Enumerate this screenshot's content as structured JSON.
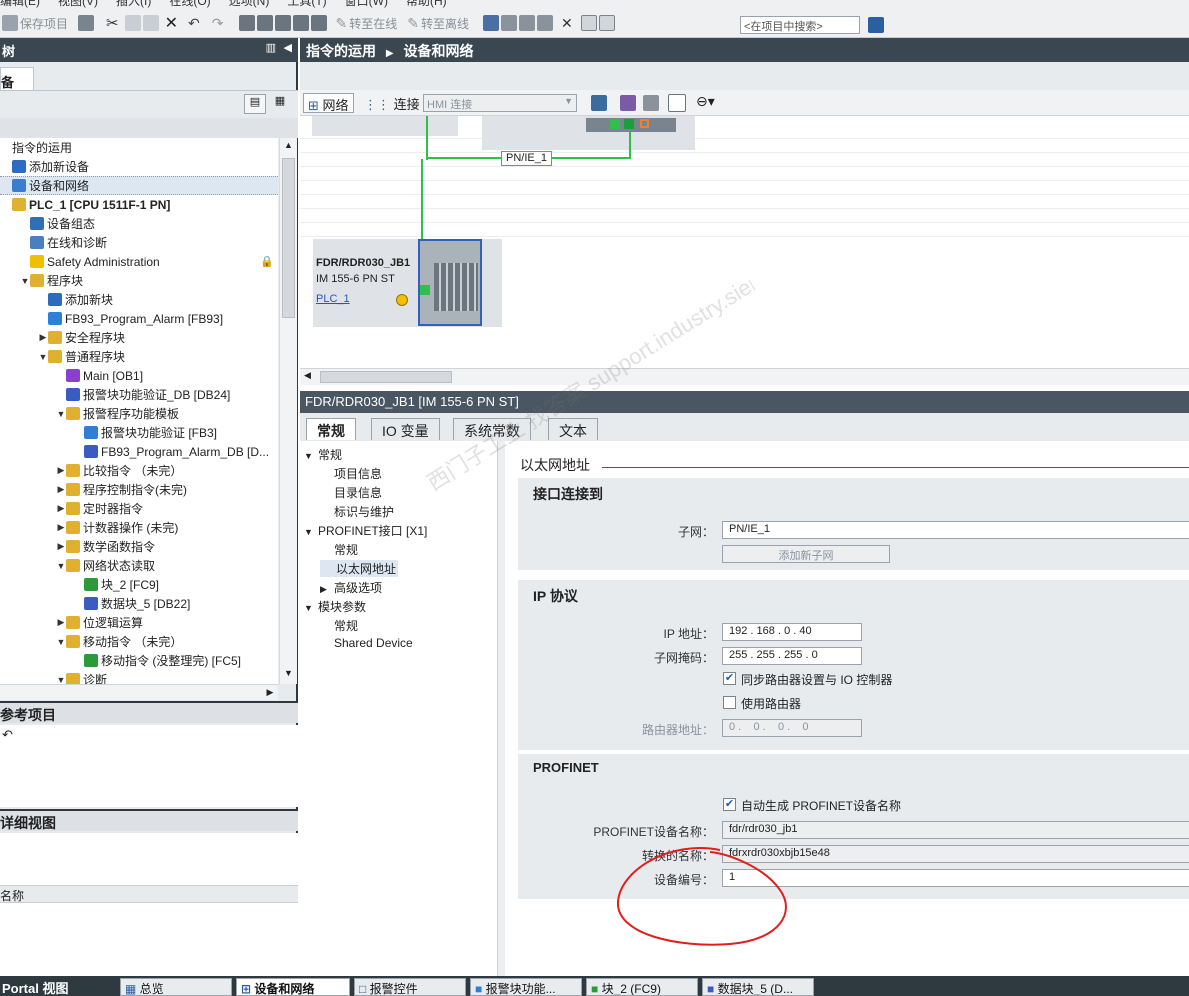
{
  "menu": {
    "items": [
      "编辑(E)",
      "视图(V)",
      "插入(I)",
      "在线(O)",
      "选项(N)",
      "工具(T)",
      "窗口(W)",
      "帮助(H)"
    ]
  },
  "toolbar": {
    "save": "保存项目",
    "go_online": "转至在线",
    "go_offline": "转至离线",
    "search_placeholder": "<在项目中搜索>"
  },
  "left": {
    "panel_title": "树",
    "tab_label": "备",
    "tree": [
      {
        "label": "指令的运用",
        "indent": 0,
        "tw": "",
        "icon": "none"
      },
      {
        "label": "添加新设备",
        "indent": 0,
        "tw": "",
        "icon": "#2c6bc0"
      },
      {
        "label": "设备和网络",
        "indent": 0,
        "tw": "",
        "icon": "#3c7bd0",
        "sel": true
      },
      {
        "label": "PLC_1 [CPU 1511F-1 PN]",
        "indent": 0,
        "tw": "",
        "icon": "#e0b030",
        "bold": true
      },
      {
        "label": "设备组态",
        "indent": 1,
        "tw": "",
        "icon": "#2f6fb5"
      },
      {
        "label": "在线和诊断",
        "indent": 1,
        "tw": "",
        "icon": "#4a7ec0"
      },
      {
        "label": "Safety Administration",
        "indent": 1,
        "tw": "",
        "icon": "#f0c000"
      },
      {
        "label": "程序块",
        "indent": 1,
        "tw": "▼",
        "icon": "#e0b030"
      },
      {
        "label": "添加新块",
        "indent": 2,
        "tw": "",
        "icon": "#2c6bc0"
      },
      {
        "label": "FB93_Program_Alarm [FB93]",
        "indent": 2,
        "tw": "",
        "icon": "#2f7fd8"
      },
      {
        "label": "安全程序块",
        "indent": 2,
        "tw": "▶",
        "icon": "#e0b030"
      },
      {
        "label": "普通程序块",
        "indent": 2,
        "tw": "▼",
        "icon": "#e0b030"
      },
      {
        "label": "Main [OB1]",
        "indent": 3,
        "tw": "",
        "icon": "#8a3fd0"
      },
      {
        "label": "报警块功能验证_DB [DB24]",
        "indent": 3,
        "tw": "",
        "icon": "#3a5cc0"
      },
      {
        "label": "报警程序功能模板",
        "indent": 3,
        "tw": "▼",
        "icon": "#e0b030"
      },
      {
        "label": "报警块功能验证 [FB3]",
        "indent": 4,
        "tw": "",
        "icon": "#2f7fd8"
      },
      {
        "label": "FB93_Program_Alarm_DB [D...",
        "indent": 4,
        "tw": "",
        "icon": "#3a5cc0"
      },
      {
        "label": "比较指令 （未完）",
        "indent": 3,
        "tw": "▶",
        "icon": "#e0b030"
      },
      {
        "label": "程序控制指令(未完)",
        "indent": 3,
        "tw": "▶",
        "icon": "#e0b030"
      },
      {
        "label": "定时器指令",
        "indent": 3,
        "tw": "▶",
        "icon": "#e0b030"
      },
      {
        "label": "计数器操作 (未完)",
        "indent": 3,
        "tw": "▶",
        "icon": "#e0b030"
      },
      {
        "label": "数学函数指令",
        "indent": 3,
        "tw": "▶",
        "icon": "#e0b030"
      },
      {
        "label": "网络状态读取",
        "indent": 3,
        "tw": "▼",
        "icon": "#e0b030"
      },
      {
        "label": "块_2 [FC9]",
        "indent": 4,
        "tw": "",
        "icon": "#2a9a3a"
      },
      {
        "label": "数据块_5 [DB22]",
        "indent": 4,
        "tw": "",
        "icon": "#3a5cc0"
      },
      {
        "label": "位逻辑运算",
        "indent": 3,
        "tw": "▶",
        "icon": "#e0b030"
      },
      {
        "label": "移动指令 （未完）",
        "indent": 3,
        "tw": "▼",
        "icon": "#e0b030"
      },
      {
        "label": "移动指令 (没整理完) [FC5]",
        "indent": 4,
        "tw": "",
        "icon": "#2a9a3a"
      },
      {
        "label": "诊断",
        "indent": 3,
        "tw": "▼",
        "icon": "#e0b030"
      }
    ],
    "ref_title": "参考项目",
    "detail_title": "详细视图",
    "detail_col": "名称"
  },
  "main": {
    "breadcrumb1": "指令的运用",
    "breadcrumb2": "设备和网络",
    "network_label": "网络",
    "connect_label": "连接",
    "hmi_connect": "HMI 连接",
    "subnet_label": "PN/IE_1",
    "device": {
      "name": "FDR/RDR030_JB1",
      "type": "IM 155-6 PN ST",
      "link": "PLC_1"
    }
  },
  "inspector": {
    "title": "FDR/RDR030_JB1 [IM 155-6 PN ST]",
    "tabs": [
      "常规",
      "IO 变量",
      "系统常数",
      "文本"
    ],
    "nav": [
      {
        "label": "常规",
        "lvl": 0,
        "tw": "▼"
      },
      {
        "label": "项目信息",
        "lvl": 1,
        "tw": ""
      },
      {
        "label": "目录信息",
        "lvl": 1,
        "tw": ""
      },
      {
        "label": "标识与维护",
        "lvl": 1,
        "tw": ""
      },
      {
        "label": "PROFINET接口 [X1]",
        "lvl": 0,
        "tw": "▼"
      },
      {
        "label": "常规",
        "lvl": 1,
        "tw": ""
      },
      {
        "label": "以太网地址",
        "lvl": 1,
        "tw": "",
        "sel": true
      },
      {
        "label": "高级选项",
        "lvl": 1,
        "tw": "▶"
      },
      {
        "label": "模块参数",
        "lvl": 0,
        "tw": "▼"
      },
      {
        "label": "常规",
        "lvl": 1,
        "tw": ""
      },
      {
        "label": "Shared Device",
        "lvl": 1,
        "tw": ""
      }
    ],
    "section": "以太网地址",
    "g1": "接口连接到",
    "subnet_lbl": "子网",
    "subnet_val": "PN/IE_1",
    "add_subnet": "添加新子网",
    "g2": "IP 协议",
    "ip_lbl": "IP 地址",
    "ip": [
      "192",
      "168",
      "0",
      "40"
    ],
    "mask_lbl": "子网掩码",
    "mask": [
      "255",
      "255",
      "255",
      "0"
    ],
    "sync_router": "同步路由器设置与 IO 控制器",
    "use_router": "使用路由器",
    "router_lbl": "路由器地址",
    "router": [
      "0",
      "0",
      "0",
      "0"
    ],
    "g3": "PROFINET",
    "auto_name": "自动生成 PROFINET设备名称",
    "pn_name_lbl": "PROFINET设备名称",
    "pn_name": "fdr/rdr030_jb1",
    "conv_lbl": "转换的名称",
    "conv": "fdrxrdr030xbjb15e48",
    "devno_lbl": "设备编号",
    "devno": "1"
  },
  "watermark": "西门子工业 找答案 support.industry.siemens.com/cs",
  "taskbar": {
    "portal": "Portal 视图",
    "items": [
      "总览",
      "设备和网络",
      "报警控件",
      "报警块功能...",
      "块_2 (FC9)",
      "数据块_5 (D..."
    ]
  }
}
